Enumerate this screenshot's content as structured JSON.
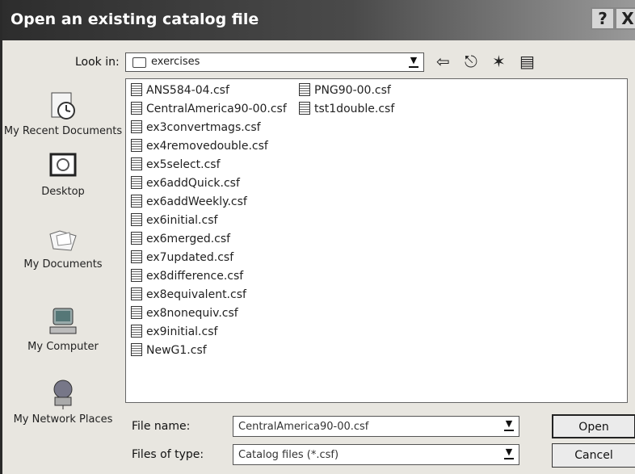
{
  "dialog": {
    "title": "Open an existing catalog file",
    "help_label": "?",
    "close_label": "X"
  },
  "toolbar": {
    "look_in_label": "Look in:",
    "look_in_value": "exercises",
    "back_icon_char": "⇦",
    "up_icon_char": "⎋",
    "new_folder_icon_char": "✶",
    "views_icon_char": "▤"
  },
  "places": [
    {
      "label": "My Recent Documents",
      "icon": "recent-documents-icon"
    },
    {
      "label": "Desktop",
      "icon": "desktop-icon"
    },
    {
      "label": "My Documents",
      "icon": "my-documents-icon"
    },
    {
      "label": "My Computer",
      "icon": "my-computer-icon"
    },
    {
      "label": "My Network Places",
      "icon": "network-places-icon"
    }
  ],
  "files": {
    "column1": [
      "ANS584-04.csf",
      "CentralAmerica90-00.csf",
      "ex3convertmags.csf",
      "ex4removedouble.csf",
      "ex5select.csf",
      "ex6addQuick.csf",
      "ex6addWeekly.csf",
      "ex6initial.csf",
      "ex6merged.csf",
      "ex7updated.csf",
      "ex8difference.csf",
      "ex8equivalent.csf",
      "ex8nonequiv.csf",
      "ex9initial.csf",
      "NewG1.csf"
    ],
    "column2": [
      "PNG90-00.csf",
      "tst1double.csf"
    ]
  },
  "form": {
    "file_name_label": "File name:",
    "file_name_value": "CentralAmerica90-00.csf",
    "file_type_label": "Files of type:",
    "file_type_value": "Catalog files (*.csf)",
    "open_label": "Open",
    "cancel_label": "Cancel"
  }
}
